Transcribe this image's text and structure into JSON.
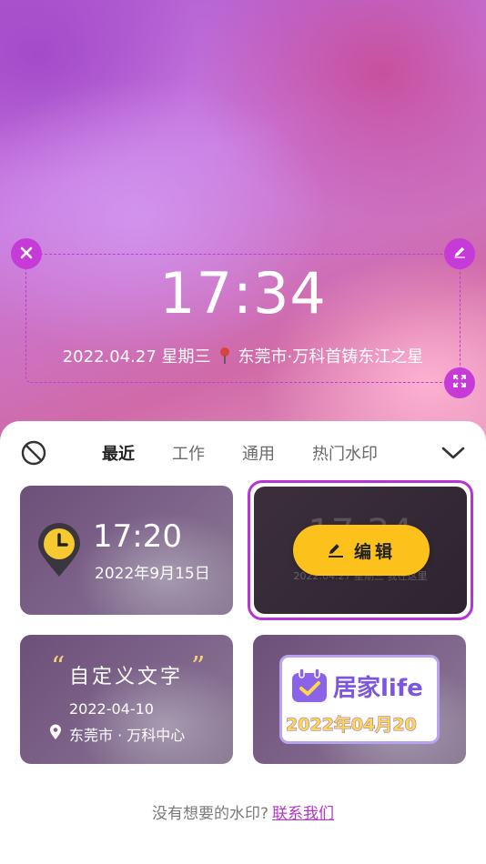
{
  "preview": {
    "time": "17:34",
    "date_weekday": "2022.04.27 星期三",
    "location": "东莞市·万科首铸东江之星"
  },
  "tabs": [
    {
      "label": "最近",
      "active": true
    },
    {
      "label": "工作",
      "active": false
    },
    {
      "label": "通用",
      "active": false
    },
    {
      "label": "热门水印",
      "active": false
    }
  ],
  "templates": [
    {
      "time": "17:20",
      "date": "2022年9月15日"
    },
    {
      "ghost_time": "17:34",
      "ghost_info": "2022.04.27 星期三   我在这里",
      "edit_label": "编辑"
    },
    {
      "quote_open": "“",
      "custom_text": "自定义文字",
      "quote_close": "”",
      "date": "2022-04-10",
      "location": "东莞市 · 万科中心"
    },
    {
      "title": "居家life",
      "date": "2022年04月20"
    }
  ],
  "footer": {
    "question": "没有想要的水印?",
    "link": "联系我们"
  },
  "colors": {
    "accent": "#c63bd8",
    "edit_button": "#fcc21b"
  }
}
